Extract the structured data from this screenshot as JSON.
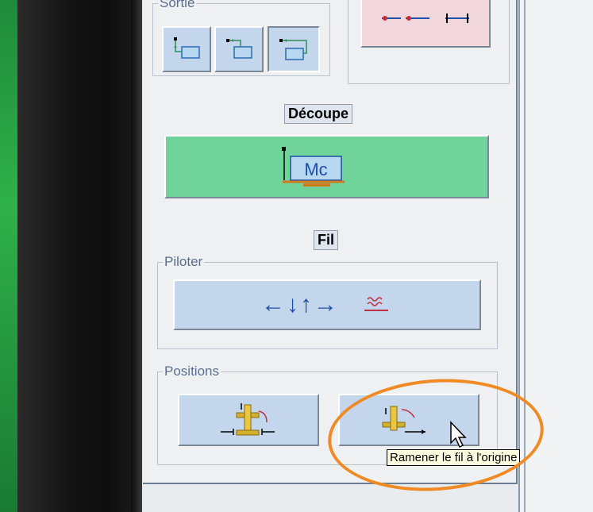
{
  "sortie": {
    "legend": "Sortie",
    "buttons": [
      {
        "name": "sortie-option-1"
      },
      {
        "name": "sortie-option-2"
      },
      {
        "name": "sortie-option-3"
      }
    ]
  },
  "decoupe": {
    "heading": "Découpe",
    "button_glyph": "Mc"
  },
  "fil": {
    "heading": "Fil"
  },
  "piloter": {
    "legend": "Piloter",
    "arrows": "←↓↑→"
  },
  "positions": {
    "legend": "Positions"
  },
  "tooltip": {
    "text": "Ramener le fil à l'origine"
  },
  "colors": {
    "highlight": "#f08a24",
    "decoupe_button": "#6fd39a",
    "pilot_button": "#c3d6ec"
  }
}
